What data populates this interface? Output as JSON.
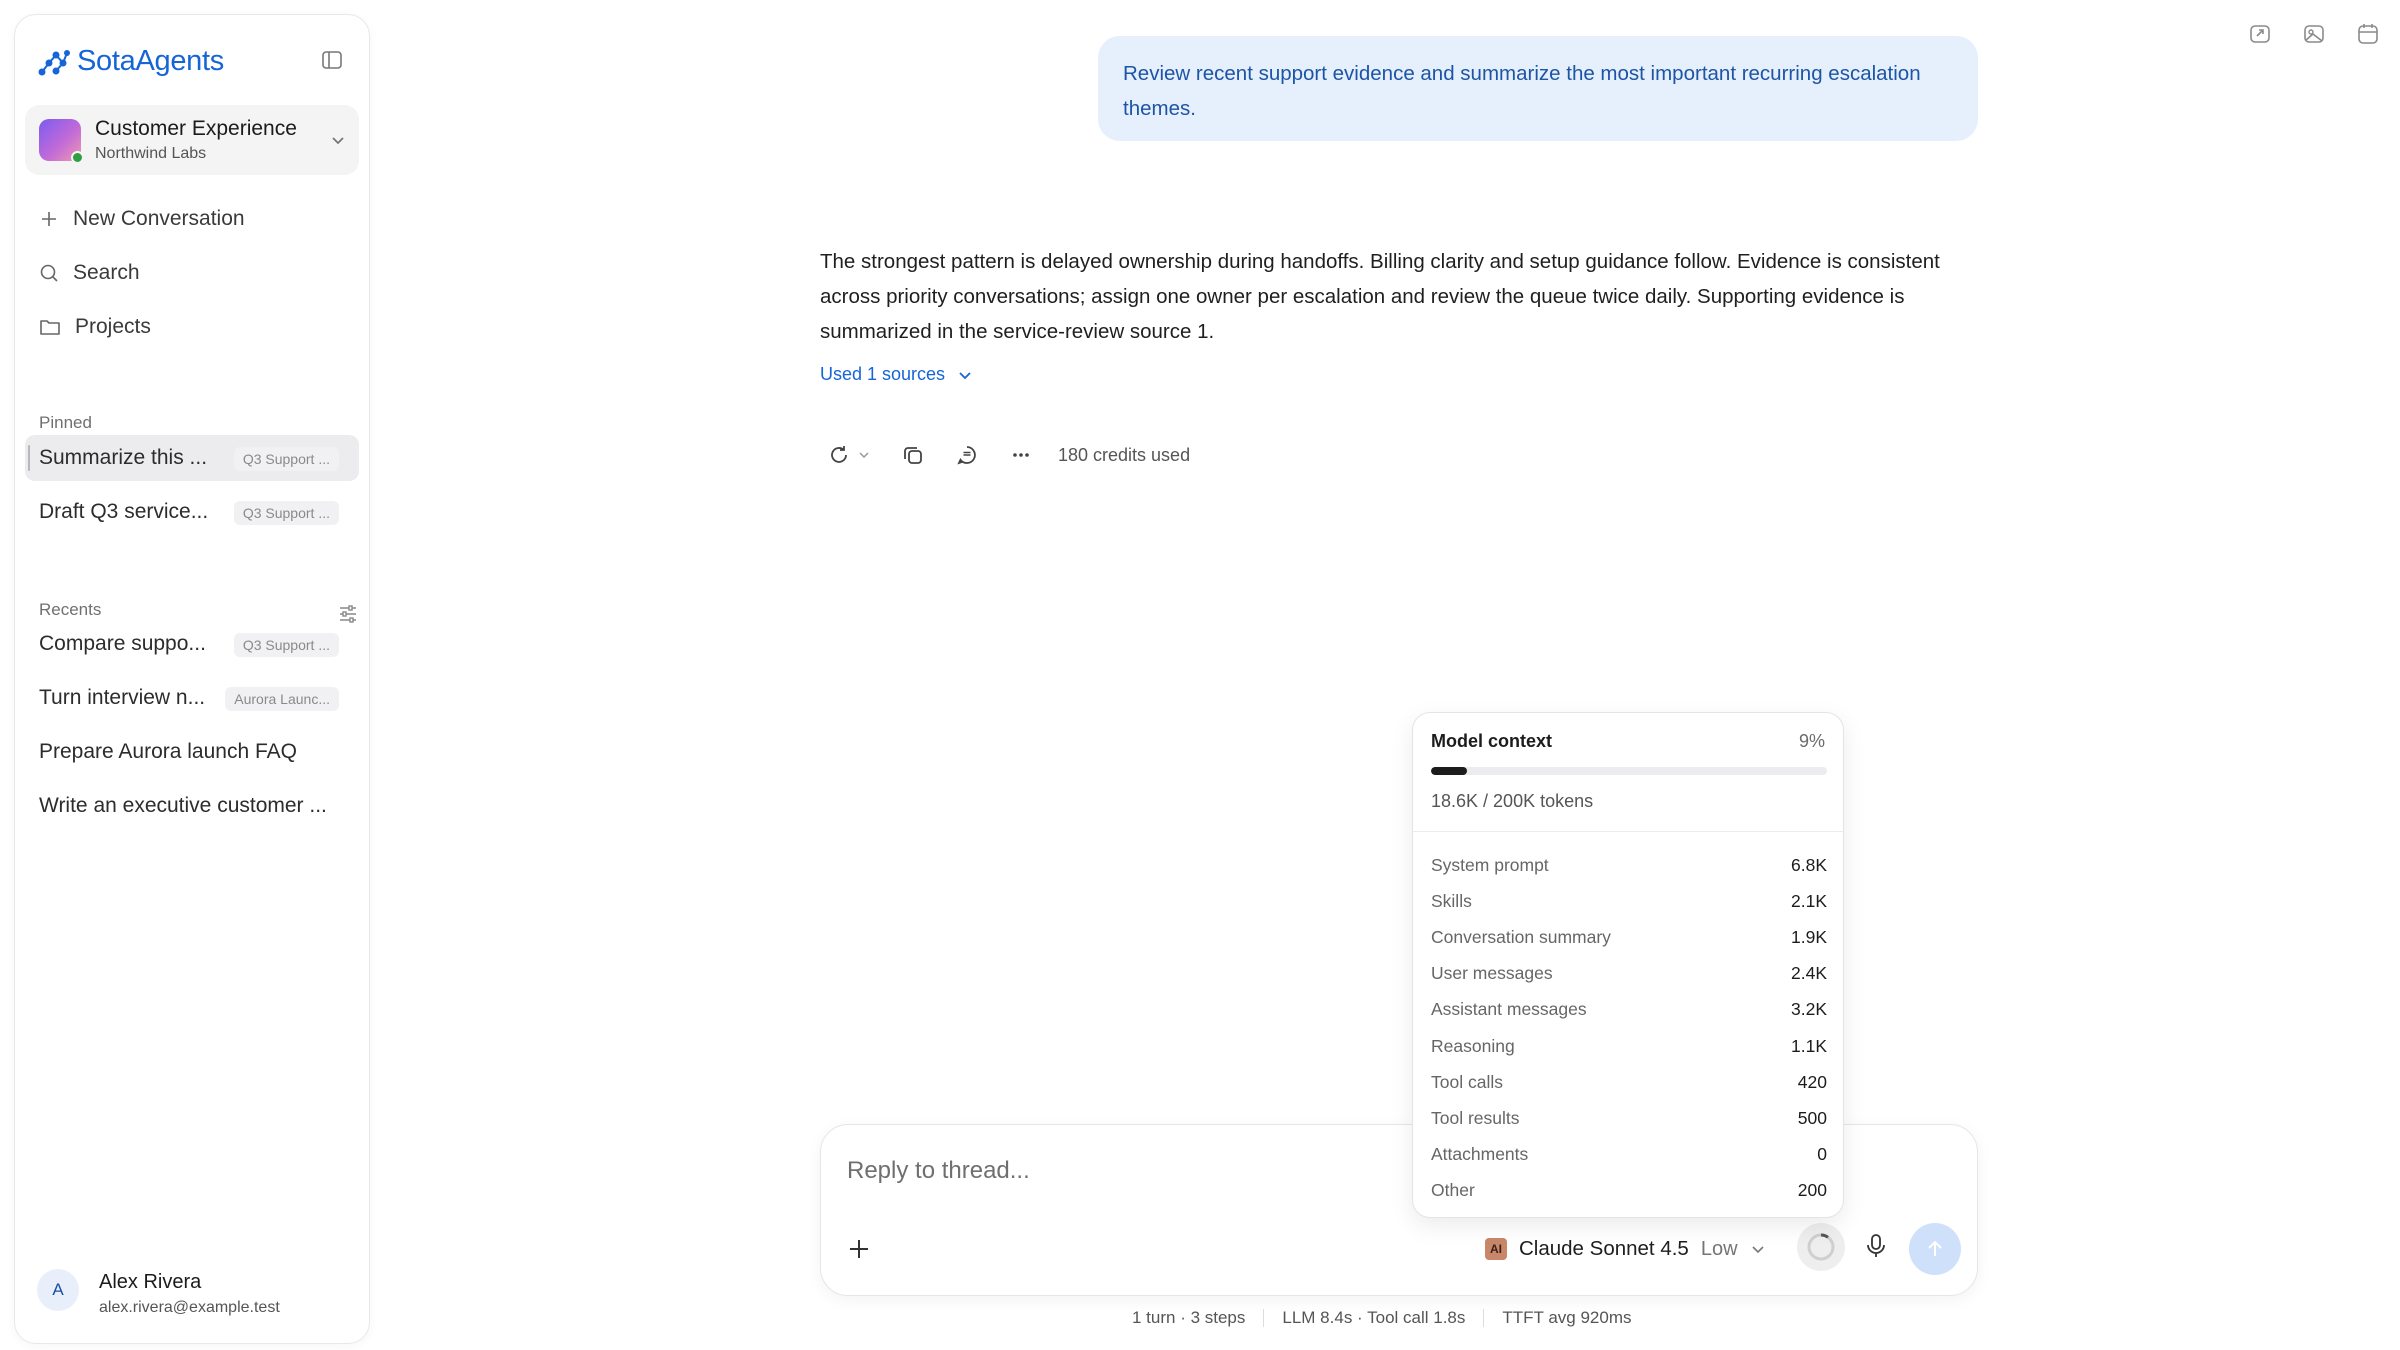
{
  "app": {
    "name": "SotaAgents",
    "brand_color": "#1565d8"
  },
  "workspace": {
    "name": "Customer Experience",
    "org": "Northwind Labs",
    "status": "online"
  },
  "nav": {
    "new_conversation": "New Conversation",
    "search": "Search",
    "projects": "Projects"
  },
  "pinned": {
    "label": "Pinned",
    "items": [
      {
        "title": "Summarize this conversation",
        "display_title": "Summarize this ...",
        "tag": "Q3 Support ...",
        "active": true
      },
      {
        "title": "Draft Q3 service...",
        "display_title": "Draft Q3 service...",
        "tag": "Q3 Support ..."
      }
    ]
  },
  "recents": {
    "label": "Recents",
    "items": [
      {
        "display_title": "Compare suppo...",
        "tag": "Q3 Support ..."
      },
      {
        "display_title": "Turn interview n...",
        "tag": "Aurora Launc..."
      },
      {
        "display_title": "Prepare Aurora launch FAQ",
        "tag": ""
      },
      {
        "display_title": "Write an executive customer ...",
        "tag": ""
      }
    ]
  },
  "user": {
    "initial": "A",
    "name": "Alex Rivera",
    "email": "alex.rivera@example.test"
  },
  "top_icons": [
    "share-icon",
    "image-icon",
    "calendar-icon"
  ],
  "chat": {
    "user_message": "Review recent support evidence and summarize the most important recurring escalation themes.",
    "assistant_message": "The strongest pattern is delayed ownership during handoffs. Billing clarity and setup guidance follow. Evidence is consistent across priority conversations; assign one owner per escalation and review the queue twice daily. Supporting evidence is summarized in the service-review source 1.",
    "sources_label": "Used 1 sources",
    "credits": "180 credits used"
  },
  "composer": {
    "placeholder": "Reply to thread...",
    "model": "Claude Sonnet 4.5",
    "model_logo": "AI",
    "effort": "Low"
  },
  "stats": {
    "turns": "1 turn · 3 steps",
    "timing": "LLM 8.4s · Tool call 1.8s",
    "ttft": "TTFT avg 920ms"
  },
  "context_popup": {
    "title": "Model context",
    "percent": "9%",
    "usage_fraction": 0.09,
    "tokens": "18.6K / 200K tokens",
    "rows": [
      {
        "label": "System prompt",
        "value": "6.8K"
      },
      {
        "label": "Skills",
        "value": "2.1K"
      },
      {
        "label": "Conversation summary",
        "value": "1.9K"
      },
      {
        "label": "User messages",
        "value": "2.4K"
      },
      {
        "label": "Assistant messages",
        "value": "3.2K"
      },
      {
        "label": "Reasoning",
        "value": "1.1K"
      },
      {
        "label": "Tool calls",
        "value": "420"
      },
      {
        "label": "Tool results",
        "value": "500"
      },
      {
        "label": "Attachments",
        "value": "0"
      },
      {
        "label": "Other",
        "value": "200"
      }
    ]
  }
}
